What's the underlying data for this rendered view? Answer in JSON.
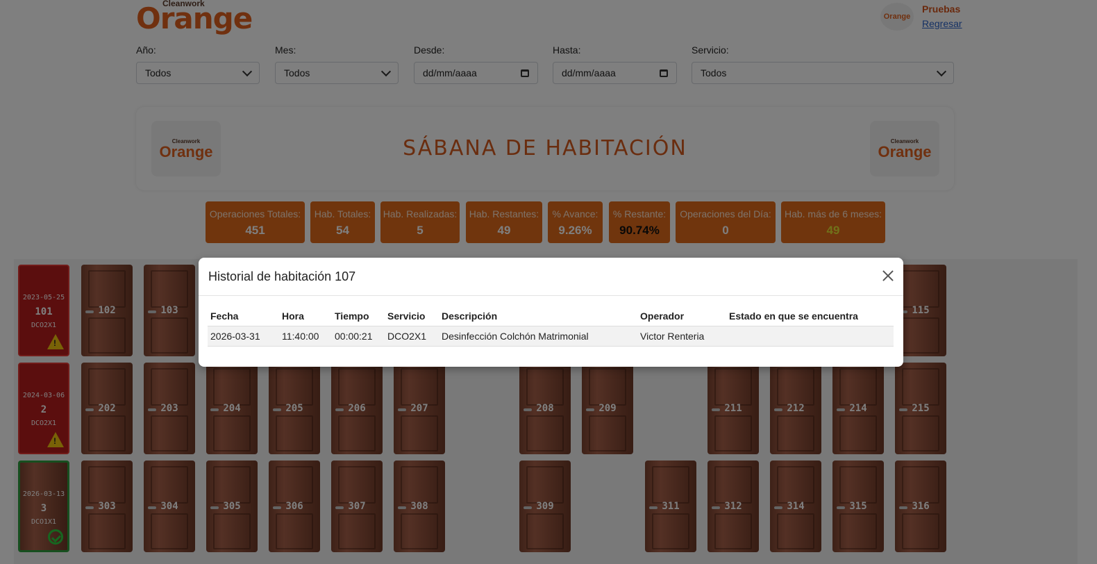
{
  "header": {
    "logo_small": "Cleanwork",
    "logo_big": "Orange",
    "user_name": "Pruebas",
    "back_link": "Regresar"
  },
  "filters": [
    {
      "label": "Año:",
      "value": "Todos",
      "kind": "select"
    },
    {
      "label": "Mes:",
      "value": "Todos",
      "kind": "select"
    },
    {
      "label": "Desde:",
      "value": "dd/mm/aaaa",
      "kind": "date"
    },
    {
      "label": "Hasta:",
      "value": "dd/mm/aaaa",
      "kind": "date"
    },
    {
      "label": "Servicio:",
      "value": "Todos",
      "kind": "select"
    }
  ],
  "banner": {
    "title": "SÁBANA DE HABITACIÓN"
  },
  "stats": [
    {
      "label": "Operaciones Totales:",
      "value": "451"
    },
    {
      "label": "Hab. Totales:",
      "value": "54"
    },
    {
      "label": "Hab. Realizadas:",
      "value": "5"
    },
    {
      "label": "Hab. Restantes:",
      "value": "49"
    },
    {
      "label": "% Avance:",
      "value": "9.26%"
    },
    {
      "label": "% Restante:",
      "value": "90.74%"
    },
    {
      "label": "Operaciones del Día:",
      "value": "0"
    },
    {
      "label": "Hab. más de 6 meses:",
      "value": "49"
    }
  ],
  "rooms": {
    "row1": [
      {
        "num": "101",
        "date": "2023-05-25",
        "svc": "DCO2X1",
        "status": "warning"
      },
      {
        "num": "102"
      },
      {
        "num": "103"
      },
      {
        "num": "115"
      }
    ],
    "row2": [
      {
        "num": "2",
        "date": "2024-03-06",
        "svc": "DCO2X1",
        "status": "warning"
      },
      {
        "num": "202"
      },
      {
        "num": "203"
      },
      {
        "num": "204"
      },
      {
        "num": "205"
      },
      {
        "num": "206"
      },
      {
        "num": "207"
      },
      {
        "num": "208"
      },
      {
        "num": "209"
      },
      {
        "num": "211"
      },
      {
        "num": "212"
      },
      {
        "num": "214"
      },
      {
        "num": "215"
      }
    ],
    "row3": [
      {
        "num": "3",
        "date": "2026-03-13",
        "svc": "DCO1X1",
        "status": "ok"
      },
      {
        "num": "303"
      },
      {
        "num": "304"
      },
      {
        "num": "305"
      },
      {
        "num": "306"
      },
      {
        "num": "307"
      },
      {
        "num": "308"
      },
      {
        "num": "309"
      },
      {
        "num": "311"
      },
      {
        "num": "312"
      },
      {
        "num": "314"
      },
      {
        "num": "315"
      },
      {
        "num": "316"
      }
    ]
  },
  "modal": {
    "title": "Historial de habitación 107",
    "columns": [
      "Fecha",
      "Hora",
      "Tiempo",
      "Servicio",
      "Descripción",
      "Operador",
      "Estado en que se encuentra"
    ],
    "rows": [
      [
        "2026-03-31",
        "11:40:00",
        "00:00:21",
        "DCO2X1",
        "Desinfección Colchón Matrimonial",
        "Victor Renteria",
        ""
      ]
    ]
  },
  "colors": {
    "brand_orange": "#e06a1a",
    "title_orange": "#d45a1f",
    "warn_red": "#b71c1c",
    "ok_green": "#2e9e3e"
  }
}
